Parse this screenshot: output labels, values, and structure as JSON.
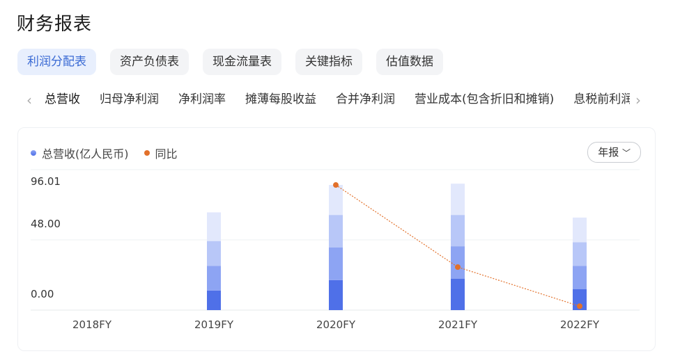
{
  "page": {
    "title": "财务报表"
  },
  "tabs": [
    {
      "label": "利润分配表",
      "active": true
    },
    {
      "label": "资产负债表"
    },
    {
      "label": "现金流量表"
    },
    {
      "label": "关键指标"
    },
    {
      "label": "估值数据"
    }
  ],
  "subtabs": [
    {
      "label": "总营收",
      "active": true
    },
    {
      "label": "归母净利润"
    },
    {
      "label": "净利润率"
    },
    {
      "label": "摊薄每股收益"
    },
    {
      "label": "合并净利润"
    },
    {
      "label": "营业成本(包含折旧和摊销)"
    },
    {
      "label": "息税前利润"
    }
  ],
  "icons": {
    "prev": "chevron-left-icon",
    "next": "chevron-right-icon",
    "dropdown": "chevron-down-icon"
  },
  "period_selector": {
    "label": "年报"
  },
  "legend": [
    {
      "label": "总营收(亿人民币)",
      "color": "#6f88e6"
    },
    {
      "label": "同比",
      "color": "#e2702a"
    }
  ],
  "colors": {
    "stack": [
      "#4f70e8",
      "#8da4f3",
      "#b8c7f8",
      "#e2e8fc"
    ],
    "line": "#e2702a"
  },
  "chart_data": {
    "type": "bar",
    "categories": [
      "2018FY",
      "2019FY",
      "2020FY",
      "2021FY",
      "2022FY"
    ],
    "series": [
      {
        "name": "总营收(亿人民币)",
        "values": [
          0,
          75,
          96,
          91,
          71
        ]
      }
    ],
    "stack_segments": [
      [
        0,
        0,
        0,
        0
      ],
      [
        15,
        19,
        19,
        22
      ],
      [
        23,
        25,
        25,
        23
      ],
      [
        24,
        25,
        24,
        24
      ],
      [
        16,
        18,
        18,
        19
      ]
    ],
    "yoy_points": [
      null,
      null,
      96,
      33,
      3
    ],
    "y_ticks": [
      "96.01",
      "48.00",
      "0.00"
    ],
    "ylim": [
      0,
      96.01
    ]
  }
}
